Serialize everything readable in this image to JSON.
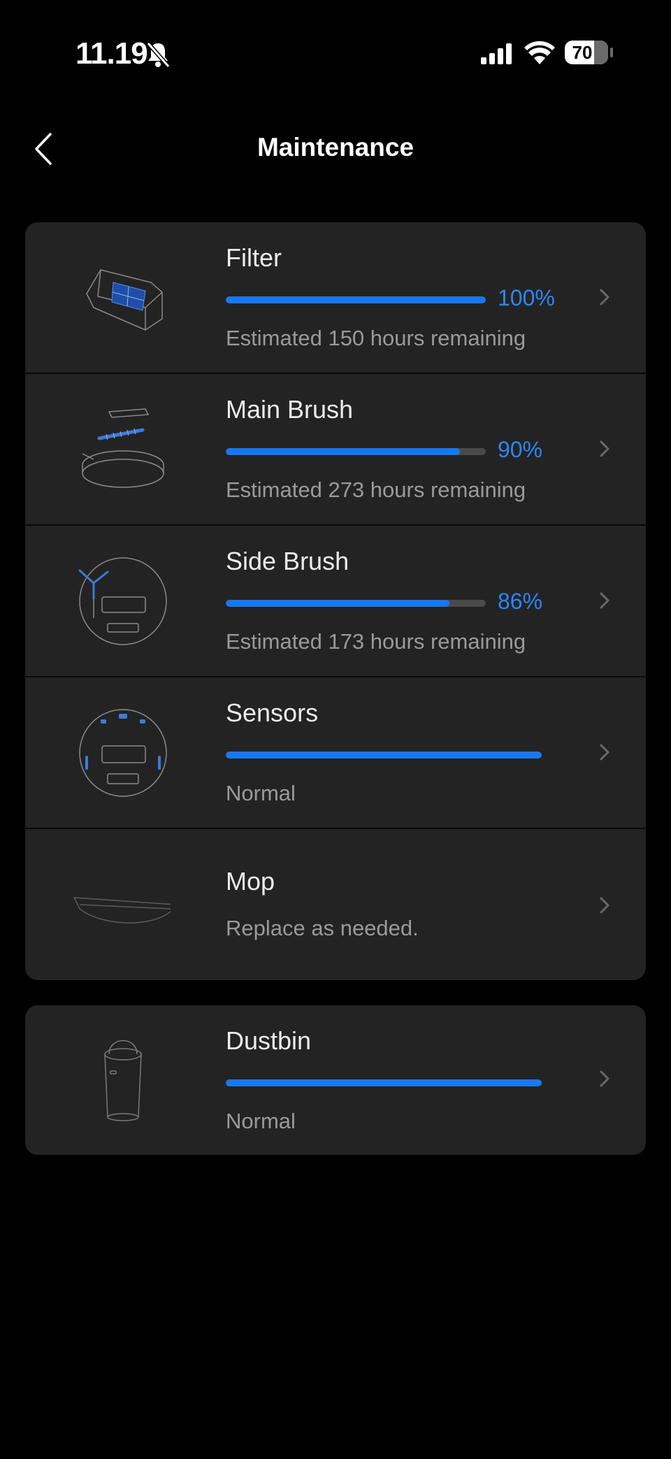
{
  "status": {
    "time": "11.19",
    "battery": "70"
  },
  "header": {
    "title": "Maintenance"
  },
  "items": [
    {
      "name": "Filter",
      "percent": "100%",
      "level": 1.0,
      "subtitle": "Estimated 150 hours remaining"
    },
    {
      "name": "Main Brush",
      "percent": "90%",
      "level": 0.9,
      "subtitle": "Estimated 273 hours remaining"
    },
    {
      "name": "Side Brush",
      "percent": "86%",
      "level": 0.86,
      "subtitle": "Estimated 173 hours remaining"
    },
    {
      "name": "Sensors",
      "level": 1.0,
      "subtitle": "Normal"
    },
    {
      "name": "Mop",
      "subtitle": "Replace as needed."
    }
  ],
  "dustbin": {
    "name": "Dustbin",
    "level": 1.0,
    "subtitle": "Normal"
  },
  "colors": {
    "accent": "#1778f2",
    "card": "#232323",
    "background": "#000000"
  },
  "icons": [
    "bell-slash-icon",
    "cellular-signal-icon",
    "wifi-icon",
    "battery-icon",
    "back-chevron-icon",
    "chevron-right-icon"
  ]
}
